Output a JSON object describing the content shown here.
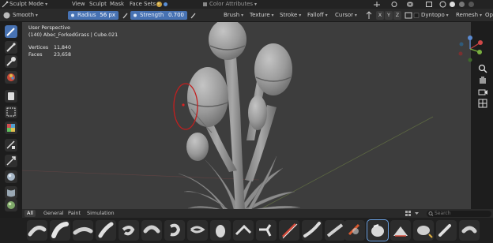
{
  "topbar": {
    "mode": "Sculpt Mode",
    "menus": [
      "View",
      "Sculpt",
      "Mask",
      "Face Sets"
    ],
    "color_attributes": "Color Attributes"
  },
  "toolbar": {
    "brush_name": "Smooth",
    "radius_label": "Radius",
    "radius_value": "56 px",
    "strength_label": "Strength",
    "strength_value": "0.700",
    "menus": [
      "Brush",
      "Texture",
      "Stroke",
      "Falloff",
      "Cursor"
    ],
    "axes": [
      "X",
      "Y",
      "Z"
    ],
    "dyntopo": "Dyntopo",
    "remesh": "Remesh",
    "options_truncated": "Op"
  },
  "overlay": {
    "perspective": "User Perspective",
    "object": "(140) Abec_ForkedGrass | Cube.021",
    "stats": [
      {
        "label": "Vertices",
        "value": "11,840"
      },
      {
        "label": "Faces",
        "value": "23,658"
      }
    ]
  },
  "bottom": {
    "tabs": [
      "All",
      "General",
      "Paint",
      "Simulation"
    ],
    "active_tab": "All",
    "search_placeholder": "Search"
  },
  "colors": {
    "viewport_bg": "#3d3d3d",
    "accent": "#4772b3",
    "annotation_red": "#c21f1f",
    "mesh": "#9e9e9e"
  },
  "icons": {
    "left_tools": [
      "draw-brush-icon",
      "smooth-brush-icon",
      "grab-brush-icon",
      "paint-brush-icon",
      "mask-brush-icon",
      "box-mask-icon",
      "face-set-icon",
      "trim-icon",
      "line-project-icon",
      "mesh-filter-icon",
      "cloth-filter-icon",
      "color-filter-icon",
      "edit-face-set-icon",
      "mask-by-color-icon",
      "transform-icon"
    ],
    "nav": [
      "zoom-icon",
      "pan-hand-icon",
      "camera-icon",
      "grid-icon"
    ]
  }
}
